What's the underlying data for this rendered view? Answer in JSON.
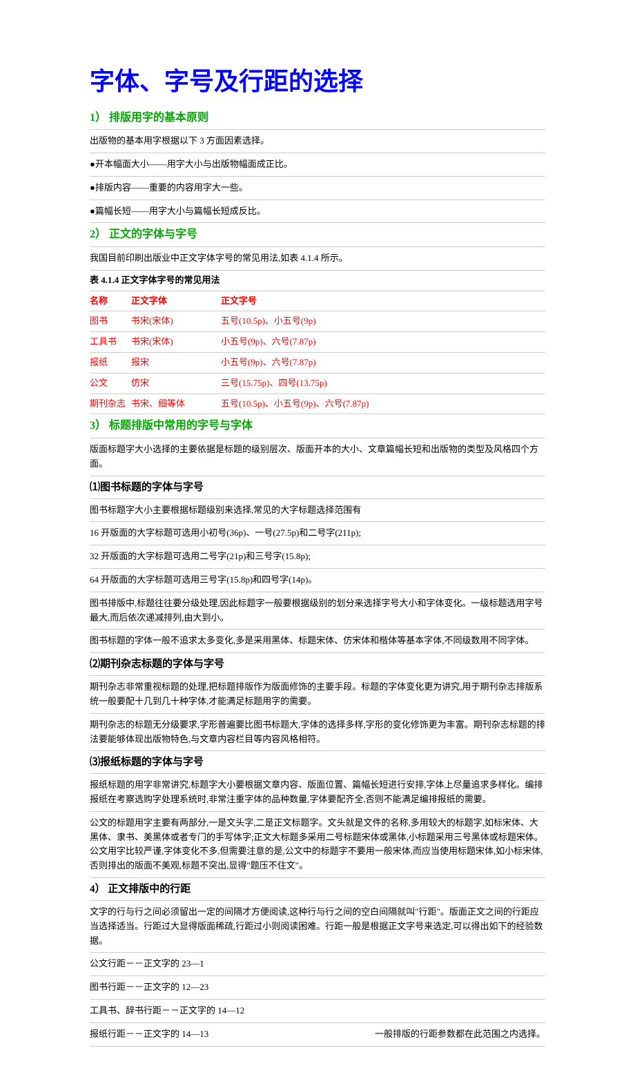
{
  "title": "字体、字号及行距的选择",
  "s1": {
    "heading": "1） 排版用字的基本原则",
    "intro": "出版物的基本用字根据以下 3 方面因素选择。",
    "b1": "●开本幅面大小——用字大小与出版物幅面成正比。",
    "b2": "●排版内容——重要的内容用字大一些。",
    "b3": "●篇幅长短——用字大小与篇幅长短成反比。"
  },
  "s2": {
    "heading": "2） 正文的字体与字号",
    "intro": "我国目前印刷出版业中正文字体字号的常见用法,如表 4.1.4 所示。",
    "caption": "表 4.1.4 正文字体字号的常见用法",
    "headers": {
      "c1": "名称",
      "c2": "正文字体",
      "c3": "正文字号"
    },
    "rows": [
      {
        "c1": "图书",
        "c2": "书宋(宋体)",
        "c3": "五号(10.5p)、小五号(9p)"
      },
      {
        "c1": "工具书",
        "c2": "书宋(宋体)",
        "c3": "小五号(9p)、六号(7.87p)"
      },
      {
        "c1": "报纸",
        "c2": "报宋",
        "c3": "小五号(9p)、六号(7.87p)"
      },
      {
        "c1": "公文",
        "c2": "仿宋",
        "c3": "三号(15.75p)、四号(13.75p)"
      },
      {
        "c1": "期刊杂志",
        "c2": "书宋、细等体",
        "c3": "五号(10.5p)、小五号(9p)、六号(7.87p)"
      }
    ]
  },
  "s3": {
    "heading": "3） 标题排版中常用的字号与字体",
    "intro": "版面标题字大小选择的主要依据是标题的级别层次、版面开本的大小、文章篇幅长短和出版物的类型及风格四个方面。",
    "sub1": {
      "heading": "⑴图书标题的字体与字号",
      "p1": "图书标题字大小主要根据标题级别来选择,常见的大字标题选择范围有",
      "p2": "16 开版面的大字标题可选用小初号(36p)、一号(27.5p)和二号字(211p);",
      "p3": "32 开版面的大字标题可选用二号字(21p)和三号字(15.8p);",
      "p4": "64 开版面的大字标题可选用三号字(15.8p)和四号字(14p)。",
      "p5": "图书排版中,标题往往要分级处理,因此标题字一般要根据级别的划分来选择字号大小和字体变化。一级标题选用字号最大,而后依次递减排列,由大到小。",
      "p6": "图书标题的字体一般不追求太多变化,多是采用黑体、标题宋体、仿宋体和楷体等基本字体,不同级数用不同字体。"
    },
    "sub2": {
      "heading": "⑵期刊杂志标题的字体与字号",
      "p1": "期刊杂志非常重视标题的处理,把标题排版作为版面修饰的主要手段。标题的字体变化更为讲究,用于期刊杂志排版系统一般要配十几到几十种字体,才能满足标题用字的需要。",
      "p2": "期刊杂志的标题无分级要求,字形普遍要比图书标题大,字体的选择多样,字形的变化修饰更为丰富。期刊杂志标题的排法要能够体现出版物特色,与文章内容栏目等内容风格相符。"
    },
    "sub3": {
      "heading": "⑶报纸标题的字体与字号",
      "p1": "报纸标题的用字非常讲究,标题字大小要根据文章内容、版面位置、篇幅长短进行安排,字体上尽量追求多样化。编排报纸在考察选购字处理系统时,非常注重字体的品种数量,字体要配齐全,否则不能满足编排报纸的需要。",
      "p2": "公文的标题用字主要有两部分,一是文头字,二是正文标题字。文头就是文件的名称,多用较大的标题字,如标宋体、大黑体、隶书、美黑体或者专门的手写体字;正文大标题多采用二号标题宋体或黑体,小标题采用三号黑体或标题宋体。公文用字比较严谨,字体变化不多,但需要注意的是,公文中的标题字不要用一般宋体,而应当使用标题宋体,如小标宋体,否则排出的版面不美观,标题不突出,显得\"题压不住文\"。"
    }
  },
  "s4": {
    "heading": "4） 正文排版中的行距",
    "p1": "文字的行与行之间必须留出一定的间隔才方便阅读,这种行与行之间的空白间隔就叫\"行距\"。版面正文之间的行距应当选择适当。行距过大显得版面稀疏,行距过小则阅读困难。行距一般是根据正文字号来选定,可以得出如下的经验数据。",
    "p2": "公文行距－－正文字的 23—1",
    "p3": "图书行距－－正文字的 12—23",
    "p4": "工具书、辞书行距－－正文字的 14—12",
    "p5": "报纸行距－－正文字的 14—13",
    "p5r": "一般排版的行距参数都在此范围之内选择。"
  }
}
